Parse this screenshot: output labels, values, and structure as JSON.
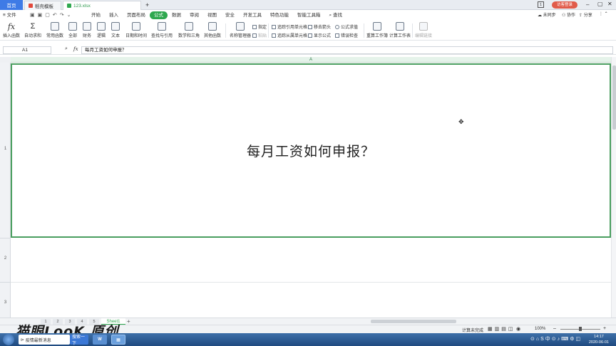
{
  "tabs": {
    "home": "首页",
    "template": "稻壳模板",
    "file": "123.xlsx",
    "new_tab": "+"
  },
  "menu": {
    "file": "文件",
    "items": [
      "开始",
      "插入",
      "页面布局",
      "公式",
      "数据",
      "审阅",
      "视图",
      "安全",
      "开发工具",
      "特色功能",
      "智能工具箱"
    ],
    "active_index": 3,
    "search": "查找",
    "sync": "未同步",
    "collab": "协作",
    "share": "分享",
    "login": "访客登录"
  },
  "ribbon": {
    "big": [
      "插入函数",
      "自动求和",
      "常用函数",
      "全部",
      "财务",
      "逻辑",
      "文本",
      "日期和时间",
      "查找与引用",
      "数学和三角",
      "其他函数",
      "名称管理器",
      "重算工作簿",
      "计算工作表",
      "编辑链接"
    ],
    "small": {
      "paste": "粘贴",
      "specify": "指定",
      "trace_precedents": "追踪引用单元格",
      "trace_dependents": "追踪从属单元格",
      "remove_arrows": "移去箭头",
      "show_formulas": "显示公式",
      "evaluate": "公式求值",
      "error_check": "错误检查"
    }
  },
  "formula_bar": {
    "cell_ref": "A1",
    "fx": "fx",
    "content": "每月工资如何申报？"
  },
  "grid": {
    "column": "A",
    "rows": [
      "1",
      "2",
      "3"
    ],
    "cell_a1": "每月工资如何申报？"
  },
  "sheets": {
    "nums": [
      "1",
      "2",
      "3",
      "4",
      "5"
    ],
    "active": "Sheet1",
    "add": "+"
  },
  "status": {
    "calc": "计算未完成",
    "zoom": "100%"
  },
  "watermark": "猫眼LooK 原创",
  "taskbar": {
    "notice": "疫情最新消息",
    "search_btn": "搜索一下",
    "time": "14:17",
    "date": "2020-06-01"
  }
}
